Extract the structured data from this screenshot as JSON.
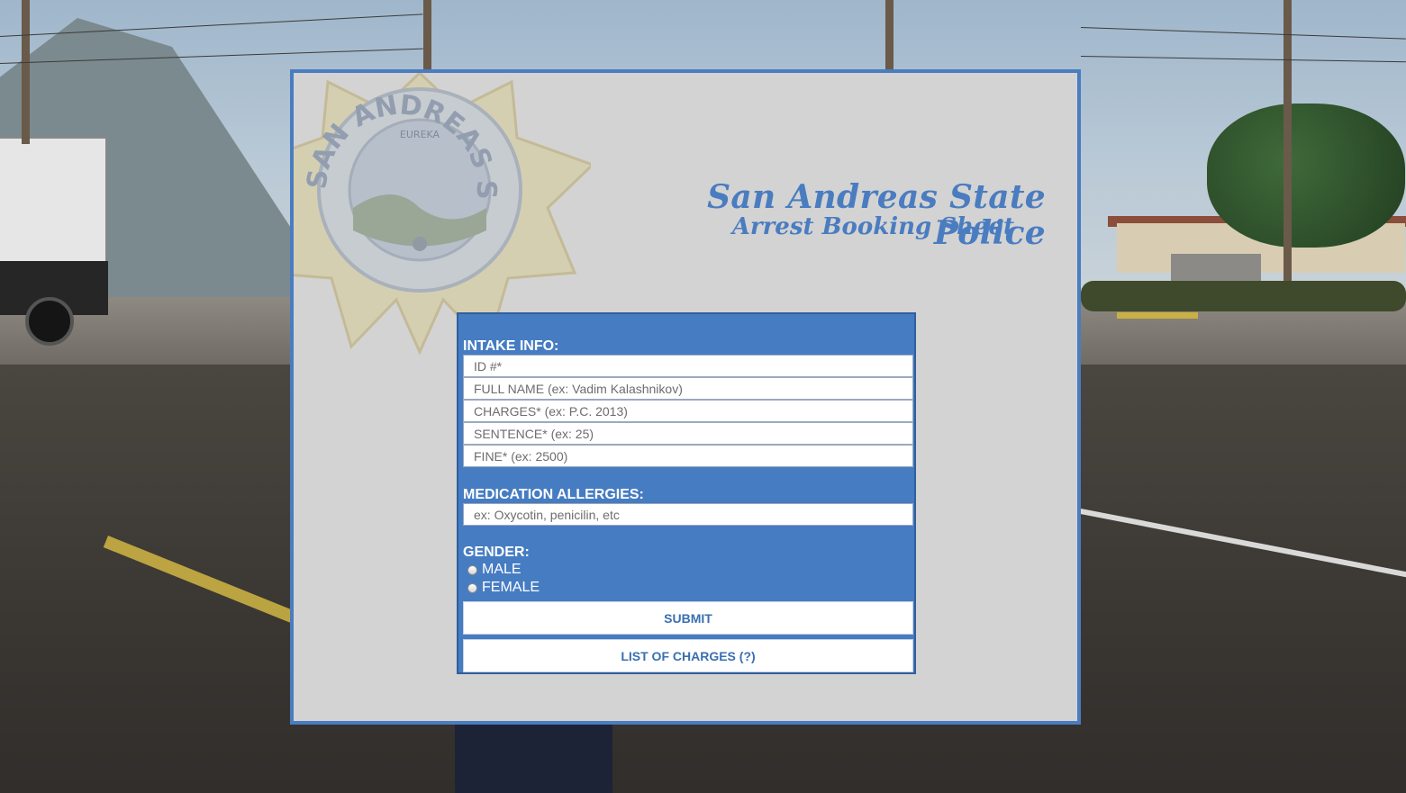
{
  "header": {
    "title": "San Andreas State Police",
    "subtitle": "Arrest Booking Sheet"
  },
  "badge": {
    "ring_text": "SAN ANDREAS STATE POLICE",
    "motto": "EUREKA"
  },
  "form": {
    "intake": {
      "label": "INTAKE INFO:",
      "id_placeholder": "ID #*",
      "name_placeholder": "FULL NAME (ex: Vadim Kalashnikov)",
      "charges_placeholder": "CHARGES* (ex: P.C. 2013)",
      "sentence_placeholder": "SENTENCE* (ex: 25)",
      "fine_placeholder": "FINE* (ex: 2500)"
    },
    "allergies": {
      "label": "MEDICATION ALLERGIES:",
      "placeholder": "ex: Oxycotin, penicilin, etc"
    },
    "gender": {
      "label": "GENDER:",
      "options": [
        "MALE",
        "FEMALE"
      ]
    },
    "submit_label": "SUBMIT",
    "charges_list_label": "LIST OF CHARGES (?)"
  },
  "colors": {
    "accent": "#4a7cc0",
    "form_background": "#467cc2",
    "sheet_background": "#d3d3d3"
  }
}
